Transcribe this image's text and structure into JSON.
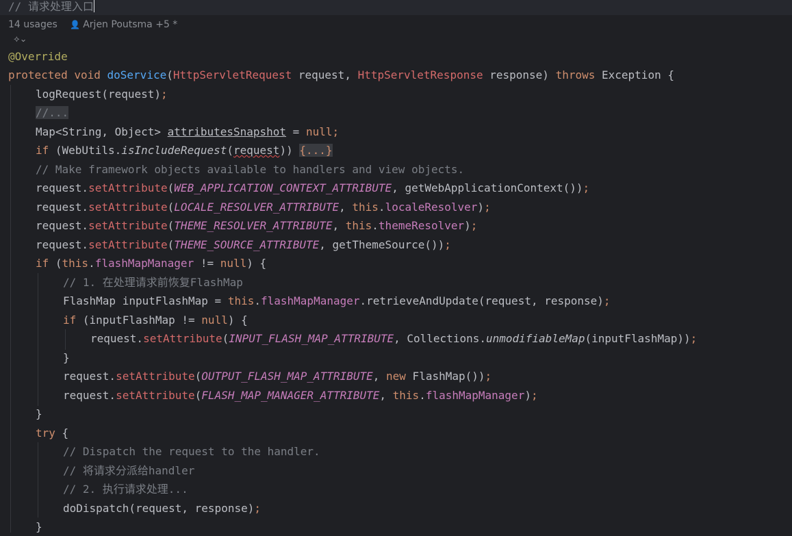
{
  "editor": {
    "header_comment": "// 请求处理入口",
    "usages": "14 usages",
    "author": "Arjen Poutsma +5 *",
    "author_icon": "person-icon",
    "ai_icon": "code-vision-icon",
    "chevron": "⌄"
  },
  "code": {
    "l1": "@Override",
    "l2": [
      "protected",
      "void",
      "doService",
      "(",
      "HttpServletRequest",
      " request, ",
      "HttpServletResponse",
      " response) ",
      "throws",
      " Exception {"
    ],
    "l3": [
      "logRequest(request)",
      ";"
    ],
    "l4": "//...",
    "l5": [
      "Map<String, Object> ",
      "attributesSnapshot",
      " = ",
      "null",
      ";"
    ],
    "l6": [
      "if",
      " (WebUtils.",
      "isIncludeRequest",
      "(",
      "request",
      ")) ",
      "{...}"
    ],
    "l7": "// Make framework objects available to handlers and view objects.",
    "l8": [
      "request.",
      "setAttribute",
      "(",
      "WEB_APPLICATION_CONTEXT_ATTRIBUTE",
      ", getWebApplicationContext())",
      ";"
    ],
    "l9": [
      "request.",
      "setAttribute",
      "(",
      "LOCALE_RESOLVER_ATTRIBUTE",
      ", ",
      "this",
      ".",
      "localeResolver",
      ")",
      ";"
    ],
    "l10": [
      "request.",
      "setAttribute",
      "(",
      "THEME_RESOLVER_ATTRIBUTE",
      ", ",
      "this",
      ".",
      "themeResolver",
      ")",
      ";"
    ],
    "l11": [
      "request.",
      "setAttribute",
      "(",
      "THEME_SOURCE_ATTRIBUTE",
      ", getThemeSource())",
      ";"
    ],
    "l12": [
      "if",
      " (",
      "this",
      ".",
      "flashMapManager",
      " != ",
      "null",
      ") {"
    ],
    "l13": "// 1. 在处理请求前恢复FlashMap",
    "l14": [
      "FlashMap inputFlashMap = ",
      "this",
      ".",
      "flashMapManager",
      ".retrieveAndUpdate(request, response)",
      ";"
    ],
    "l15": [
      "if",
      " (inputFlashMap != ",
      "null",
      ") {"
    ],
    "l16": [
      "request.",
      "setAttribute",
      "(",
      "INPUT_FLASH_MAP_ATTRIBUTE",
      ", Collections.",
      "unmodifiableMap",
      "(inputFlashMap))",
      ";"
    ],
    "l17": "}",
    "l18": [
      "request.",
      "setAttribute",
      "(",
      "OUTPUT_FLASH_MAP_ATTRIBUTE",
      ", ",
      "new",
      " FlashMap())",
      ";"
    ],
    "l19": [
      "request.",
      "setAttribute",
      "(",
      "FLASH_MAP_MANAGER_ATTRIBUTE",
      ", ",
      "this",
      ".",
      "flashMapManager",
      ")",
      ";"
    ],
    "l20": "}",
    "l21": [
      "try",
      " {"
    ],
    "l22": "// Dispatch the request to the handler.",
    "l23": "// 将请求分派给handler",
    "l24": "// 2. 执行请求处理...",
    "l25": [
      "doDispatch(request, response)",
      ";"
    ],
    "l26": "}"
  },
  "colors": {
    "background": "#1f2024",
    "keyword": "#cf8e6d",
    "comment": "#7a7e85",
    "field": "#c77dbb",
    "method_decl": "#56a8f5",
    "annotation": "#b3ae60",
    "inherited_method": "#d46a6a"
  }
}
